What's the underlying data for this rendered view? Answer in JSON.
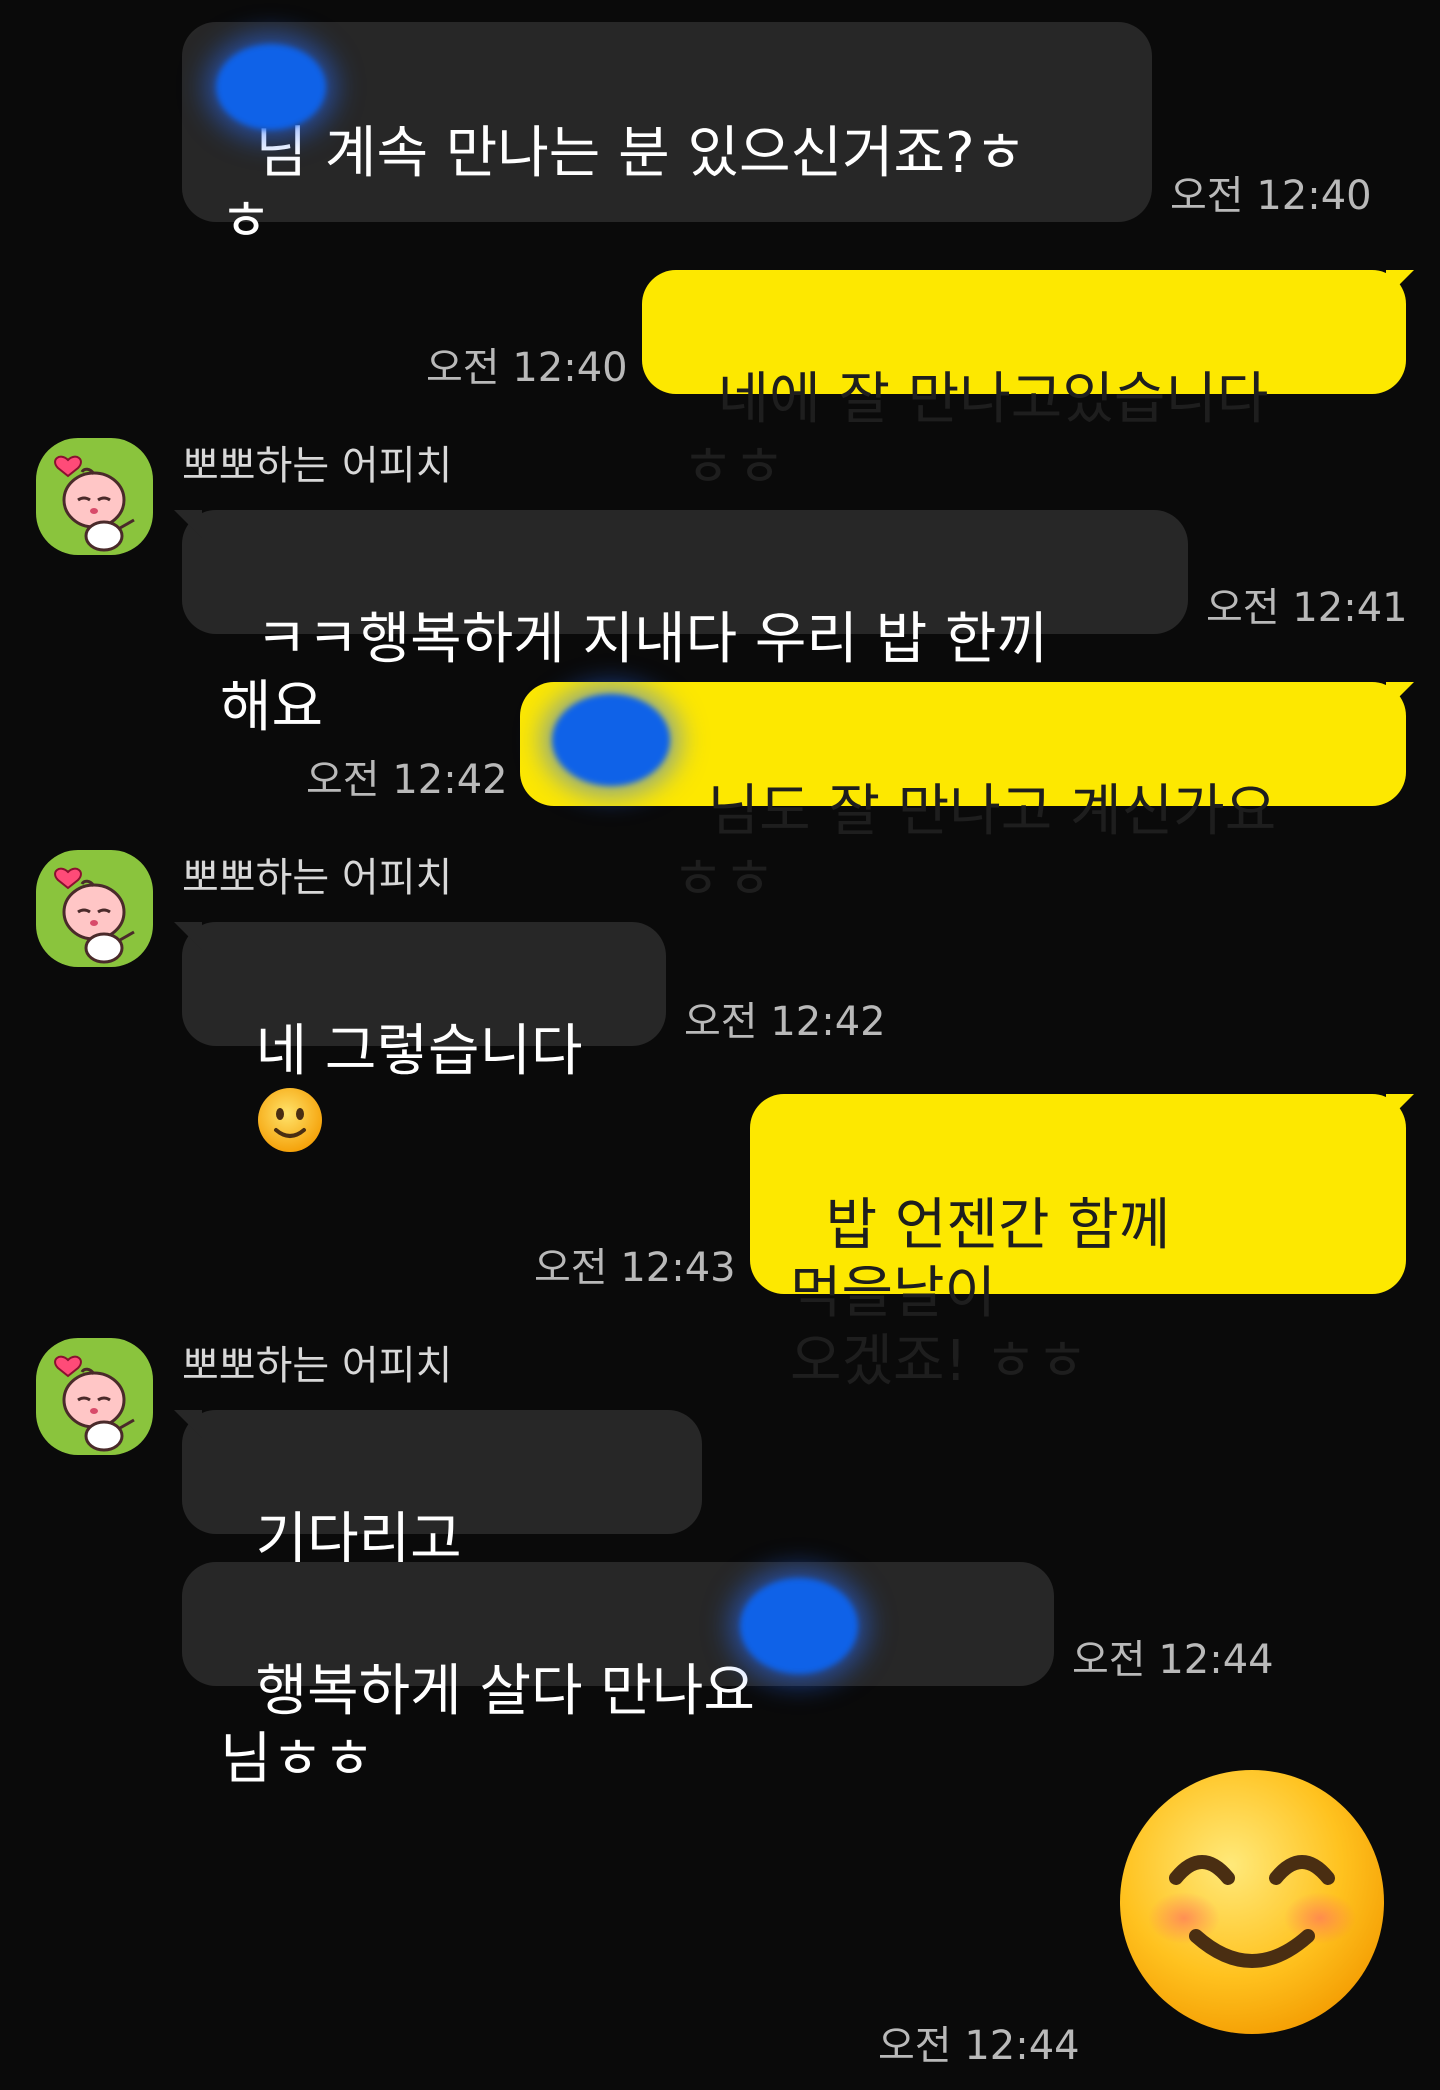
{
  "messages": [
    {
      "side": "in",
      "text": "님 계속 만나는 분 있으신거죠?ㅎ\nㅎ",
      "time": "오전 12:40",
      "redacted": true
    },
    {
      "side": "out",
      "text": "네에 잘 만나고있습니다 ㅎㅎ",
      "time": "오전 12:40"
    },
    {
      "side": "in",
      "sender": "뽀뽀하는 어피치",
      "text": "ㅋㅋ행복하게 지내다 우리 밥 한끼 해요",
      "time": "오전 12:41"
    },
    {
      "side": "out",
      "text": "님도 잘 만나고 계신가요 ㅎㅎ",
      "time": "오전 12:42",
      "redacted": true
    },
    {
      "side": "in",
      "sender": "뽀뽀하는 어피치",
      "text": "네 그렇습니다",
      "emoji": "slightly-smiling-face",
      "time": "오전 12:42"
    },
    {
      "side": "out",
      "text": "밥 언젠간 함께 먹을날이\n오겠죠! ㅎㅎ",
      "time": "오전 12:43"
    },
    {
      "side": "in",
      "sender": "뽀뽀하는 어피치",
      "text": "기다리고 있을게요"
    },
    {
      "side": "in",
      "text_before": "행복하게 살다 만나요",
      "text_after": "님ㅎㅎ",
      "time": "오전 12:44",
      "redacted": true
    },
    {
      "side": "out",
      "emoji": "smiling-face-with-smiling-eyes",
      "time": "오전 12:44"
    }
  ],
  "colors": {
    "background": "#0a0a0a",
    "incoming_bubble": "#272727",
    "outgoing_bubble": "#fde800",
    "redaction": "#0f62e8",
    "avatar": "#8ac43d"
  },
  "icons": {
    "avatar": "apeach-kiss-avatar-icon",
    "inline_emoji": "slightly-smiling-face-icon",
    "big_emoji": "smiling-face-with-smiling-eyes-icon"
  }
}
